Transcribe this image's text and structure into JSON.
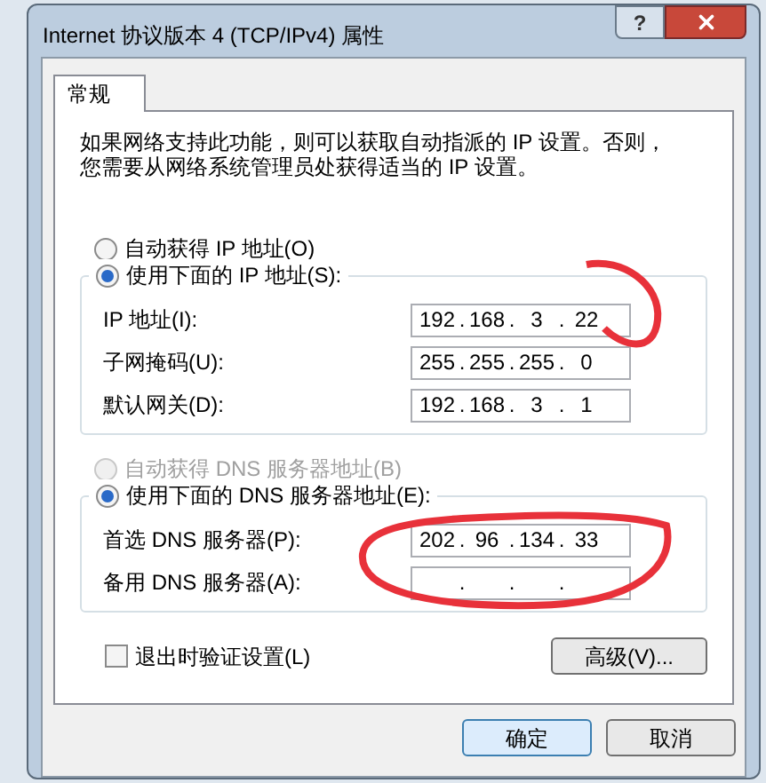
{
  "window": {
    "title": "Internet 协议版本 4 (TCP/IPv4) 属性",
    "help_button": "?"
  },
  "tabs": [
    {
      "label": "常规",
      "selected": true
    }
  ],
  "description": "如果网络支持此功能，则可以获取自动指派的 IP 设置。否则，您需要从网络系统管理员处获得适当的 IP 设置。",
  "ip_section": {
    "radios": [
      {
        "label": "自动获得 IP 地址(O)",
        "selected": false,
        "disabled": false
      },
      {
        "label": "使用下面的 IP 地址(S):",
        "selected": true,
        "disabled": false
      }
    ],
    "fields": [
      {
        "label": "IP 地址(I):",
        "separator": ".",
        "octets": [
          "192",
          "168",
          "3",
          "22"
        ]
      },
      {
        "label": "子网掩码(U):",
        "separator": ".",
        "octets": [
          "255",
          "255",
          "255",
          "0"
        ]
      },
      {
        "label": "默认网关(D):",
        "separator": ".",
        "octets": [
          "192",
          "168",
          "3",
          "1"
        ]
      }
    ]
  },
  "dns_section": {
    "radios": [
      {
        "label": "自动获得 DNS 服务器地址(B)",
        "selected": false,
        "disabled": true
      },
      {
        "label": "使用下面的 DNS 服务器地址(E):",
        "selected": true,
        "disabled": false
      }
    ],
    "fields": [
      {
        "label": "首选 DNS 服务器(P):",
        "separator": ".",
        "octets": [
          "202",
          "96",
          "134",
          "33"
        ]
      },
      {
        "label": "备用 DNS 服务器(A):",
        "separator": "."
      }
    ]
  },
  "validate_checkbox": {
    "label": "退出时验证设置(L)",
    "checked": false
  },
  "advanced_button": "高级(V)...",
  "buttons": [
    "确定",
    "取消"
  ]
}
